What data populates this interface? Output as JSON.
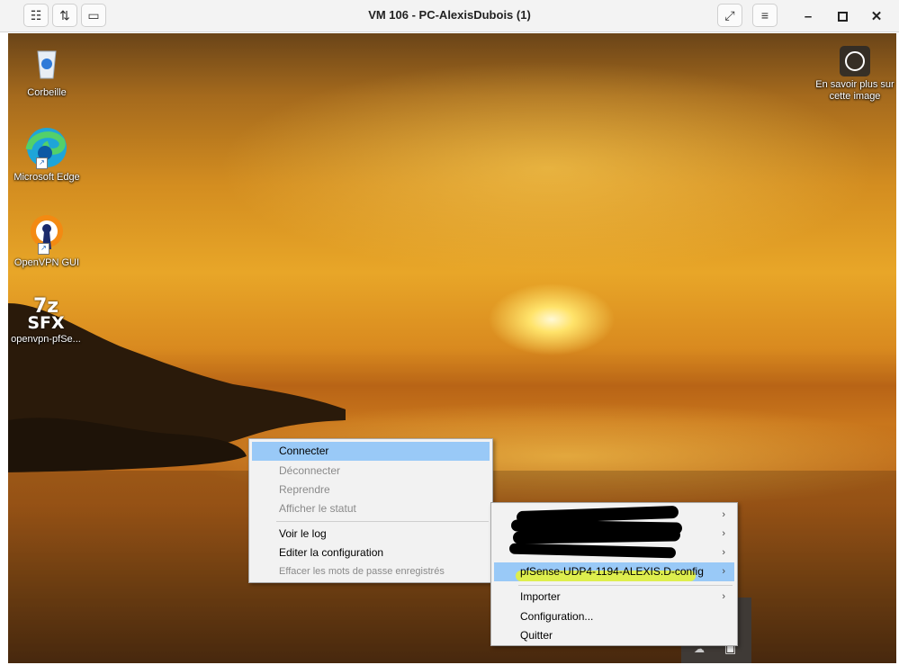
{
  "window": {
    "title": "VM 106 - PC-AlexisDubois (1)"
  },
  "desktop_icons": {
    "recycle_bin": "Corbeille",
    "edge": "Microsoft Edge",
    "openvpn": "OpenVPN GUI",
    "sfx_badge_top": "7z",
    "sfx_badge_bottom": "SFX",
    "sfx": "openvpn-pfSe...",
    "about_image": "En savoir plus sur cette image"
  },
  "context_menu": {
    "items": [
      {
        "label": "Connecter",
        "enabled": true,
        "highlighted": true
      },
      {
        "label": "Déconnecter",
        "enabled": false
      },
      {
        "label": "Reprendre",
        "enabled": false
      },
      {
        "label": "Afficher le statut",
        "enabled": false
      },
      {
        "label": "Voir le log",
        "enabled": true
      },
      {
        "label": "Editer la configuration",
        "enabled": true
      },
      {
        "label": "Effacer les mots de passe enregistrés",
        "enabled": false
      }
    ]
  },
  "tray_menu": {
    "profile": "pfSense-UDP4-1194-ALEXIS.D-config",
    "import": "Importer",
    "configuration": "Configuration...",
    "quit": "Quitter"
  },
  "colors": {
    "highlight": "#99c9f7",
    "marker": "#e5f23a",
    "menu_bg": "#f2f2f2"
  }
}
